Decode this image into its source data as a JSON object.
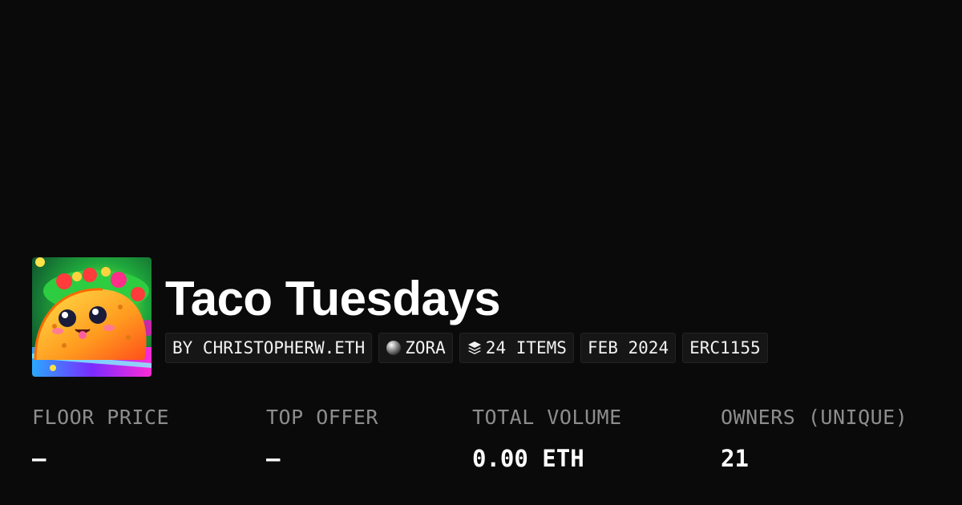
{
  "collection": {
    "title": "Taco Tuesdays",
    "avatar_icon": "taco-collection-image"
  },
  "tags": [
    {
      "label": "BY CHRISTOPHERW.ETH",
      "icon": null
    },
    {
      "label": "ZORA",
      "icon": "zora-orb-icon"
    },
    {
      "label": "24 ITEMS",
      "icon": "layers-icon"
    },
    {
      "label": "FEB 2024",
      "icon": null
    },
    {
      "label": "ERC1155",
      "icon": null
    }
  ],
  "stats": [
    {
      "label": "FLOOR PRICE",
      "value": "—"
    },
    {
      "label": "TOP OFFER",
      "value": "—"
    },
    {
      "label": "TOTAL VOLUME",
      "value": "0.00 ETH"
    },
    {
      "label": "OWNERS (UNIQUE)",
      "value": "21"
    }
  ],
  "colors": {
    "background": "#0a0a0a",
    "tag_background": "#161616",
    "label_gray": "#8d8d8d",
    "text": "#ffffff"
  }
}
